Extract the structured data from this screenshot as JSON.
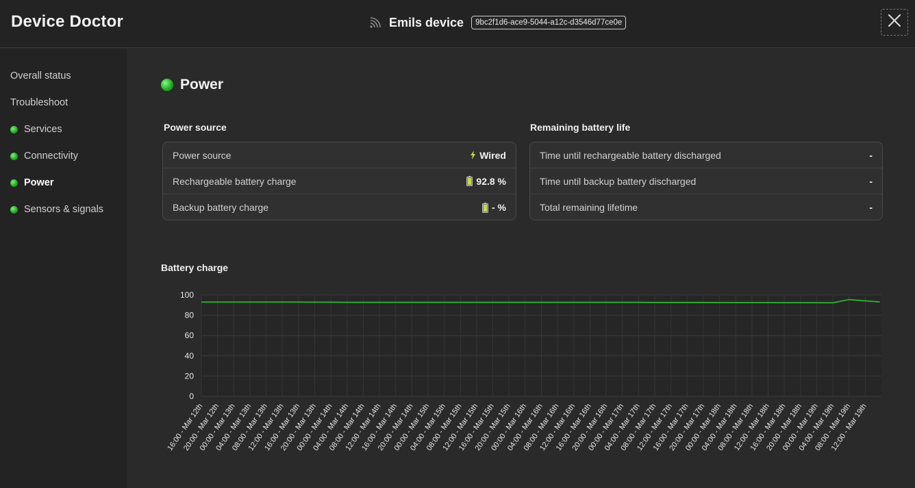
{
  "app": {
    "title": "Device Doctor"
  },
  "device": {
    "name": "Emils device",
    "id": "9bc2f1d6-ace9-5044-a12c-d3546d77ce0e"
  },
  "sidebar": {
    "items": [
      {
        "label": "Overall status",
        "status": ""
      },
      {
        "label": "Troubleshoot",
        "status": ""
      },
      {
        "label": "Services",
        "status": "ok"
      },
      {
        "label": "Connectivity",
        "status": "ok"
      },
      {
        "label": "Power",
        "status": "ok",
        "active": true
      },
      {
        "label": "Sensors & signals",
        "status": "ok"
      }
    ]
  },
  "main": {
    "title": "Power",
    "power_source": {
      "title": "Power source",
      "rows": [
        {
          "label": "Power source",
          "value": "Wired",
          "icon": "lightning-icon"
        },
        {
          "label": "Rechargeable battery charge",
          "value": "92.8 %",
          "icon": "battery-icon"
        },
        {
          "label": "Backup battery charge",
          "value": "- %",
          "icon": "battery-icon"
        }
      ]
    },
    "battery_life": {
      "title": "Remaining battery life",
      "rows": [
        {
          "label": "Time until rechargeable battery discharged",
          "value": "-"
        },
        {
          "label": "Time until backup battery discharged",
          "value": "-"
        },
        {
          "label": "Total remaining lifetime",
          "value": "-"
        }
      ]
    },
    "chart_title": "Battery charge"
  },
  "colors": {
    "accent": "#22b022",
    "line": "#2fa82f",
    "background": "#2a2a2a"
  },
  "chart_data": {
    "type": "line",
    "title": "Battery charge",
    "xlabel": "",
    "ylabel": "",
    "ylim": [
      0,
      100
    ],
    "yticks": [
      0,
      20,
      40,
      60,
      80,
      100
    ],
    "grid": true,
    "categories": [
      "16:00 - Mar 12th",
      "20:00 - Mar 12th",
      "00:00 - Mar 13th",
      "04:00 - Mar 13th",
      "08:00 - Mar 13th",
      "12:00 - Mar 13th",
      "16:00 - Mar 13th",
      "20:00 - Mar 13th",
      "00:00 - Mar 14th",
      "04:00 - Mar 14th",
      "08:00 - Mar 14th",
      "12:00 - Mar 14th",
      "16:00 - Mar 14th",
      "20:00 - Mar 14th",
      "00:00 - Mar 15th",
      "04:00 - Mar 15th",
      "08:00 - Mar 15th",
      "12:00 - Mar 15th",
      "16:00 - Mar 15th",
      "20:00 - Mar 15th",
      "00:00 - Mar 16th",
      "04:00 - Mar 16th",
      "08:00 - Mar 16th",
      "12:00 - Mar 16th",
      "16:00 - Mar 16th",
      "20:00 - Mar 16th",
      "00:00 - Mar 17th",
      "04:00 - Mar 17th",
      "08:00 - Mar 17th",
      "12:00 - Mar 17th",
      "16:00 - Mar 17th",
      "20:00 - Mar 17th",
      "00:00 - Mar 18th",
      "04:00 - Mar 18th",
      "08:00 - Mar 18th",
      "12:00 - Mar 18th",
      "16:00 - Mar 18th",
      "20:00 - Mar 18th",
      "00:00 - Mar 19th",
      "04:00 - Mar 19th",
      "08:00 - Mar 19th",
      "12:00 - Mar 19th"
    ],
    "series": [
      {
        "values": [
          93.0,
          93.0,
          93.0,
          93.0,
          93.0,
          93.0,
          93.0,
          92.9,
          92.9,
          92.8,
          92.8,
          92.8,
          92.8,
          92.8,
          92.8,
          92.8,
          92.8,
          92.8,
          92.8,
          92.8,
          92.7,
          92.7,
          92.7,
          92.7,
          92.7,
          92.7,
          92.7,
          92.7,
          92.6,
          92.6,
          92.6,
          92.6,
          92.5,
          92.5,
          92.5,
          92.5,
          92.4,
          92.4,
          92.4,
          92.3,
          95.5,
          93.2
        ]
      }
    ]
  }
}
